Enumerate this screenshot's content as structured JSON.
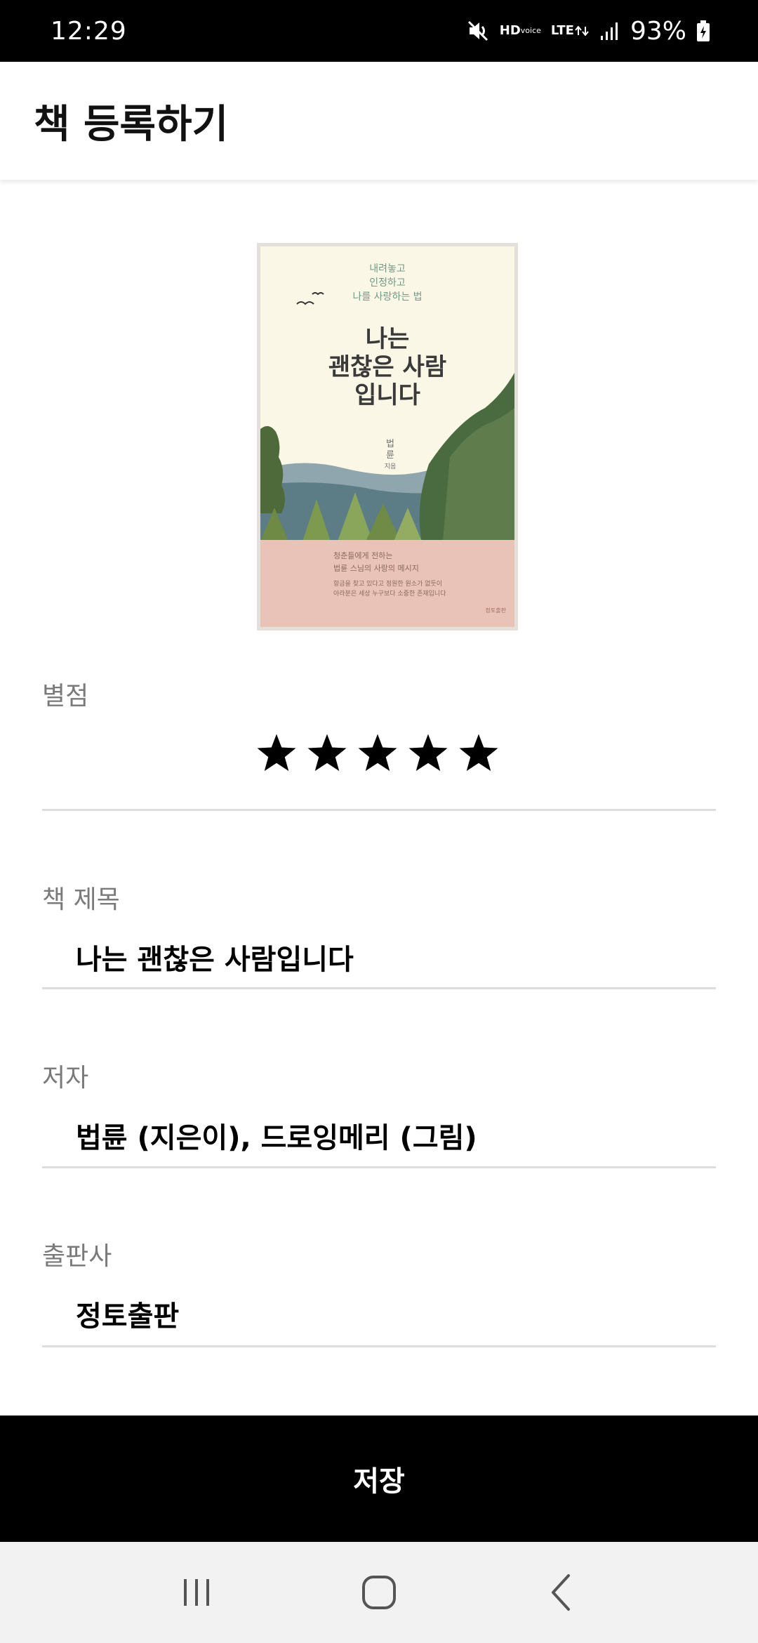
{
  "status_bar": {
    "time": "12:29",
    "battery": "93%",
    "hd_label": "HD",
    "hd_sub": "voice",
    "lte_label": "LTE",
    "icons": [
      "mute-icon",
      "hd-voice-icon",
      "lte-icon",
      "signal-icon",
      "battery-charging-icon"
    ]
  },
  "app_bar": {
    "title": "책 등록하기"
  },
  "book_cover": {
    "subtitle_lines": [
      "내려놓고",
      "인정하고",
      "나를 사랑하는 법"
    ],
    "title_lines": [
      "나는",
      "괜찮은 사람",
      "입니다"
    ],
    "author_lines": [
      "법",
      "륜",
      "지음"
    ],
    "band_heading_lines": [
      "청춘들에게 전하는",
      "법륜 스님의 사랑의 메시지"
    ],
    "band_body_lines": [
      "항금을 찾고 있다고 정원한 원소가 없듯이",
      "아라분은 세상 누구보다 소중한 존재입니다"
    ],
    "publisher": "정토출판"
  },
  "rating": {
    "label": "별점",
    "value": 5,
    "max": 5
  },
  "fields": {
    "title": {
      "label": "책 제목",
      "value": "나는 괜찮은 사람입니다"
    },
    "author": {
      "label": "저자",
      "value": "법륜 (지은이), 드로잉메리 (그림)"
    },
    "publisher": {
      "label": "출판사",
      "value": "정토출판"
    }
  },
  "save_button": {
    "label": "저장"
  },
  "nav_bar": {
    "icons": [
      "recent-apps-icon",
      "home-icon",
      "back-icon"
    ]
  },
  "colors": {
    "status_bar_bg": "#000000",
    "save_button_bg": "#000000",
    "nav_bar_bg": "#f2f2f2",
    "cover_band": "#e9c3b7",
    "cover_bg": "#fbf7e6"
  }
}
